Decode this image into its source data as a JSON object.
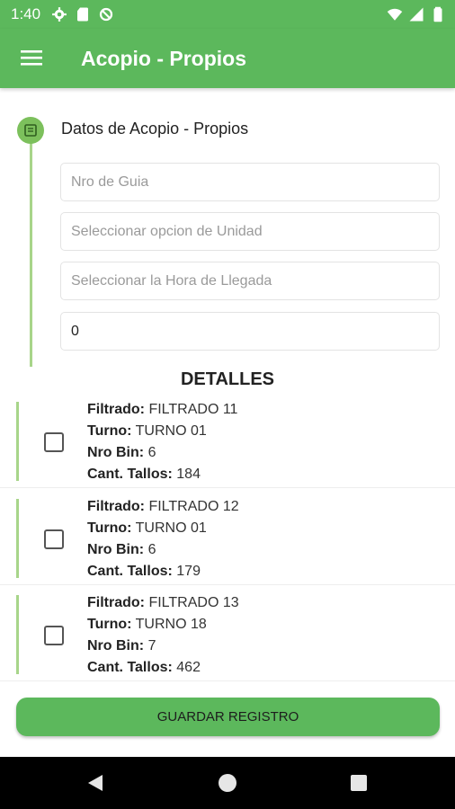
{
  "status_bar": {
    "time": "1:40",
    "icons_left": [
      "gear-icon",
      "sd-card-icon",
      "sync-icon"
    ],
    "icons_right": [
      "wifi-icon",
      "signal-icon",
      "battery-icon"
    ]
  },
  "app_bar": {
    "title": "Acopio - Propios",
    "menu_icon": "hamburger-menu-icon"
  },
  "step": {
    "title": "Datos de Acopio - Propios",
    "icon": "clipboard-icon"
  },
  "form": {
    "guia_placeholder": "Nro de Guia",
    "unidad_placeholder": "Seleccionar opcion de Unidad",
    "hora_placeholder": "Seleccionar la Hora de Llegada",
    "quantity_value": "0"
  },
  "detalles": {
    "title": "DETALLES",
    "labels": {
      "filtrado": "Filtrado:",
      "turno": "Turno:",
      "bin": "Nro Bin:",
      "tallos": "Cant. Tallos:"
    },
    "items": [
      {
        "filtrado": "FILTRADO 11",
        "turno": "TURNO 01",
        "bin": "6",
        "tallos": "184",
        "checked": false
      },
      {
        "filtrado": "FILTRADO 12",
        "turno": "TURNO 01",
        "bin": "6",
        "tallos": "179",
        "checked": false
      },
      {
        "filtrado": "FILTRADO 13",
        "turno": "TURNO 18",
        "bin": "7",
        "tallos": "462",
        "checked": false
      }
    ]
  },
  "save_button": {
    "label": "GUARDAR REGISTRO"
  },
  "colors": {
    "primary": "#5cb85c",
    "step_line": "#a8d58a",
    "nav_bar": "#000000"
  }
}
